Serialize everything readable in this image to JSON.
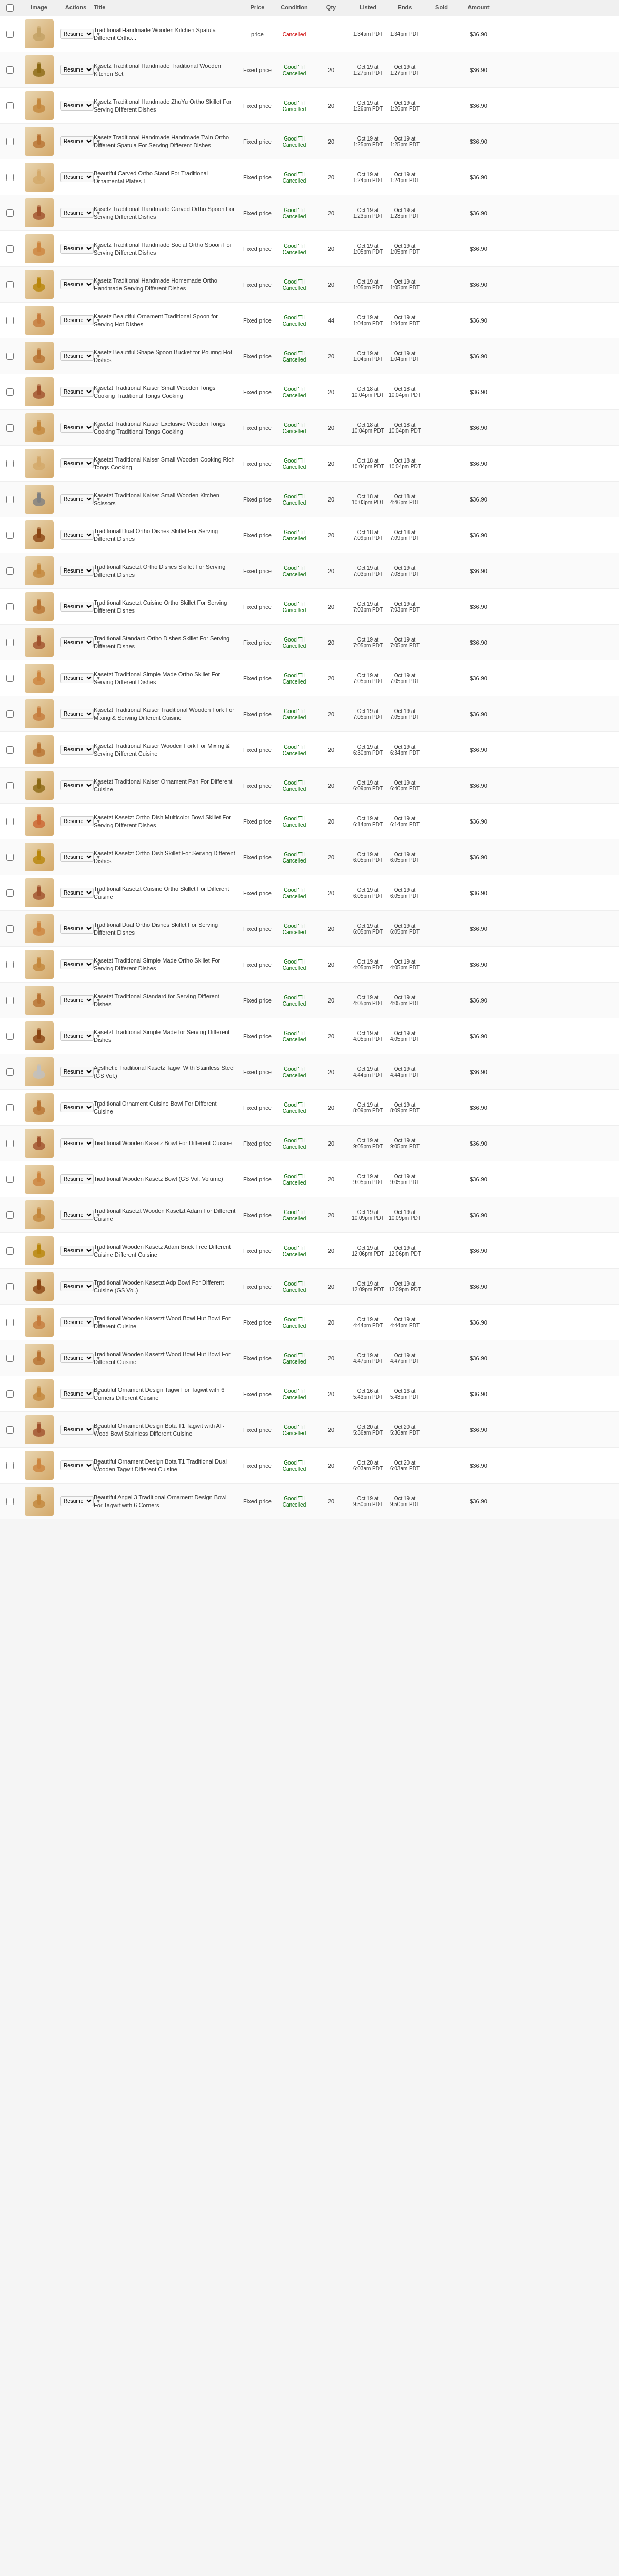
{
  "headers": {
    "check": "",
    "image": "Image",
    "actions": "Actions",
    "title": "Title",
    "price": "Price",
    "condition": "Condition",
    "qty": "Qty",
    "listed": "Listed",
    "ends": "Ends",
    "sold": "Sold",
    "amount": "Amount"
  },
  "rows": [
    {
      "id": 1,
      "title": "Traditional Handmade Wooden Kitchen Spatula Different Ortho...",
      "price": "price",
      "condition": "Cancelled",
      "qty": "",
      "listed": "1:34am PDT",
      "ends": "1:34pm PDT",
      "sold": "",
      "amount": "$36.90",
      "color": "#c4a265"
    },
    {
      "id": 2,
      "title": "Kasetz Traditional Handmade Traditional Wooden Kitchen Set",
      "price": "Fixed price",
      "condition": "Good 'Til Cancelled",
      "qty": "20",
      "listed": "Oct 19 at 1:27pm PDT",
      "ends": "Oct 19 at 1:27pm PDT",
      "sold": "",
      "amount": "$36.90",
      "color": "#8b6914"
    },
    {
      "id": 3,
      "title": "Kasetz Traditional Handmade ZhuYu Ortho Skillet For Serving Different Dishes",
      "price": "Fixed price",
      "condition": "Good 'Til Cancelled",
      "qty": "20",
      "listed": "Oct 19 at 1:26pm PDT",
      "ends": "Oct 19 at 1:26pm PDT",
      "sold": "",
      "amount": "$36.90",
      "color": "#c4873c"
    },
    {
      "id": 4,
      "title": "Kasetz Traditional Handmade Handmade Twin Ortho Different Spatula For Serving Different Dishes",
      "price": "Fixed price",
      "condition": "Good 'Til Cancelled",
      "qty": "20",
      "listed": "Oct 19 at 1:25pm PDT",
      "ends": "Oct 19 at 1:25pm PDT",
      "sold": "",
      "amount": "$36.90",
      "color": "#b87333"
    },
    {
      "id": 5,
      "title": "Beautiful Carved Ortho Stand For Traditional Ornamental Plates I",
      "price": "Fixed price",
      "condition": "Good 'Til Cancelled",
      "qty": "20",
      "listed": "Oct 19 at 1:24pm PDT",
      "ends": "Oct 19 at 1:24pm PDT",
      "sold": "",
      "amount": "$36.90",
      "color": "#d4a96a"
    },
    {
      "id": 6,
      "title": "Kasetz Traditional Handmade Carved Ortho Spoon For Serving Different Dishes",
      "price": "Fixed price",
      "condition": "Good 'Til Cancelled",
      "qty": "20",
      "listed": "Oct 19 at 1:23pm PDT",
      "ends": "Oct 19 at 1:23pm PDT",
      "sold": "",
      "amount": "$36.90",
      "color": "#a0522d"
    },
    {
      "id": 7,
      "title": "Kasetz Traditional Handmade Social Ortho Spoon For Serving Different Dishes",
      "price": "Fixed price",
      "condition": "Good 'Til Cancelled",
      "qty": "20",
      "listed": "Oct 19 at 1:05pm PDT",
      "ends": "Oct 19 at 1:05pm PDT",
      "sold": "",
      "amount": "$36.90",
      "color": "#cd853f"
    },
    {
      "id": 8,
      "title": "Kasetz Traditional Handmade Homemade Ortho Handmade Serving Different Dishes",
      "price": "Fixed price",
      "condition": "Good 'Til Cancelled",
      "qty": "20",
      "listed": "Oct 19 at 1:05pm PDT",
      "ends": "Oct 19 at 1:05pm PDT",
      "sold": "",
      "amount": "$36.90",
      "color": "#b8860b"
    },
    {
      "id": 9,
      "title": "Kasetz Beautiful Ornament Traditional Spoon for Serving Hot Dishes",
      "price": "Fixed price",
      "condition": "Good 'Til Cancelled",
      "qty": "44",
      "listed": "Oct 19 at 1:04pm PDT",
      "ends": "Oct 19 at 1:04pm PDT",
      "sold": "",
      "amount": "$36.90",
      "color": "#c67c3d"
    },
    {
      "id": 10,
      "title": "Kasetz Beautiful Shape Spoon Bucket for Pouring Hot Dishes",
      "price": "Fixed price",
      "condition": "Good 'Til Cancelled",
      "qty": "20",
      "listed": "Oct 19 at 1:04pm PDT",
      "ends": "Oct 19 at 1:04pm PDT",
      "sold": "",
      "amount": "$36.90",
      "color": "#b87333"
    },
    {
      "id": 11,
      "title": "Kasetzt Traditional Kaiser Small Wooden Tongs Cooking Traditional Tongs Cooking",
      "price": "Fixed price",
      "condition": "Good 'Til Cancelled",
      "qty": "20",
      "listed": "Oct 18 at 10:04pm PDT",
      "ends": "Oct 18 at 10:04pm PDT",
      "sold": "",
      "amount": "$36.90",
      "color": "#a0522d"
    },
    {
      "id": 12,
      "title": "Kasetzt Traditional Kaiser Exclusive Wooden Tongs Cooking Traditional Tongs Cooking",
      "price": "Fixed price",
      "condition": "Good 'Til Cancelled",
      "qty": "20",
      "listed": "Oct 18 at 10:04pm PDT",
      "ends": "Oct 18 at 10:04pm PDT",
      "sold": "",
      "amount": "$36.90",
      "color": "#c4873c"
    },
    {
      "id": 13,
      "title": "Kasetzt Traditional Kaiser Small Wooden Cooking Rich Tongs Cooking",
      "price": "Fixed price",
      "condition": "Good 'Til Cancelled",
      "qty": "20",
      "listed": "Oct 18 at 10:04pm PDT",
      "ends": "Oct 18 at 10:04pm PDT",
      "sold": "",
      "amount": "$36.90",
      "color": "#d4a96a"
    },
    {
      "id": 14,
      "title": "Kasetzt Traditional Kaiser Small Wooden Kitchen Scissors",
      "price": "Fixed price",
      "condition": "Good 'Til Cancelled",
      "qty": "20",
      "listed": "Oct 18 at 10:03pm PDT",
      "ends": "Oct 18 at 4:46pm PDT",
      "sold": "",
      "amount": "$36.90",
      "color": "#808080"
    },
    {
      "id": 15,
      "title": "Traditional Dual Ortho Dishes Skillet For Serving Different Dishes",
      "price": "Fixed price",
      "condition": "Good 'Til Cancelled",
      "qty": "20",
      "listed": "Oct 18 at 7:09pm PDT",
      "ends": "Oct 18 at 7:09pm PDT",
      "sold": "",
      "amount": "$36.90",
      "color": "#8b4513"
    },
    {
      "id": 16,
      "title": "Traditional Kasetzt Ortho Dishes Skillet For Serving Different Dishes",
      "price": "Fixed price",
      "condition": "Good 'Til Cancelled",
      "qty": "20",
      "listed": "Oct 19 at 7:03pm PDT",
      "ends": "Oct 19 at 7:03pm PDT",
      "sold": "",
      "amount": "$36.90",
      "color": "#c4873c"
    },
    {
      "id": 17,
      "title": "Traditional Kasetzt Cuisine Ortho Skillet For Serving Different Dishes",
      "price": "Fixed price",
      "condition": "Good 'Til Cancelled",
      "qty": "20",
      "listed": "Oct 19 at 7:03pm PDT",
      "ends": "Oct 19 at 7:03pm PDT",
      "sold": "",
      "amount": "$36.90",
      "color": "#b87333"
    },
    {
      "id": 18,
      "title": "Traditional Standard Ortho Dishes Skillet For Serving Different Dishes",
      "price": "Fixed price",
      "condition": "Good 'Til Cancelled",
      "qty": "20",
      "listed": "Oct 19 at 7:05pm PDT",
      "ends": "Oct 19 at 7:05pm PDT",
      "sold": "",
      "amount": "$36.90",
      "color": "#a0522d"
    },
    {
      "id": 19,
      "title": "Kasetzt Traditional Simple Made Ortho Skillet For Serving Different Dishes",
      "price": "Fixed price",
      "condition": "Good 'Til Cancelled",
      "qty": "20",
      "listed": "Oct 19 at 7:05pm PDT",
      "ends": "Oct 19 at 7:05pm PDT",
      "sold": "",
      "amount": "$36.90",
      "color": "#cd853f"
    },
    {
      "id": 20,
      "title": "Kasetzt Traditional Kaiser Traditional Wooden Fork For Mixing & Serving Different Cuisine",
      "price": "Fixed price",
      "condition": "Good 'Til Cancelled",
      "qty": "20",
      "listed": "Oct 19 at 7:05pm PDT",
      "ends": "Oct 19 at 7:05pm PDT",
      "sold": "",
      "amount": "$36.90",
      "color": "#c67c3d"
    },
    {
      "id": 21,
      "title": "Kasetzt Traditional Kaiser Wooden Fork For Mixing & Serving Different Cuisine",
      "price": "Fixed price",
      "condition": "Good 'Til Cancelled",
      "qty": "20",
      "listed": "Oct 19 at 6:30pm PDT",
      "ends": "Oct 19 at 6:34pm PDT",
      "sold": "",
      "amount": "$36.90",
      "color": "#b87333"
    },
    {
      "id": 22,
      "title": "Kasetzt Traditional Kaiser Ornament Pan For Different Cuisine",
      "price": "Fixed price",
      "condition": "Good 'Til Cancelled",
      "qty": "20",
      "listed": "Oct 19 at 6:09pm PDT",
      "ends": "Oct 19 at 6:40pm PDT",
      "sold": "",
      "amount": "$36.90",
      "color": "#8b6914"
    },
    {
      "id": 23,
      "title": "Kasetzt Kasetzt Ortho Dish Multicolor Bowl Skillet For Serving Different Dishes",
      "price": "Fixed price",
      "condition": "Good 'Til Cancelled",
      "qty": "20",
      "listed": "Oct 19 at 6:14pm PDT",
      "ends": "Oct 19 at 6:14pm PDT",
      "sold": "",
      "amount": "$36.90",
      "color": "#cc6633"
    },
    {
      "id": 24,
      "title": "Kasetzt Kasetzt Ortho Dish Skillet For Serving Different Dishes",
      "price": "Fixed price",
      "condition": "Good 'Til Cancelled",
      "qty": "20",
      "listed": "Oct 19 at 6:05pm PDT",
      "ends": "Oct 19 at 6:05pm PDT",
      "sold": "",
      "amount": "$36.90",
      "color": "#b8860b"
    },
    {
      "id": 25,
      "title": "Traditional Kasetzt Cuisine Ortho Skillet For Different Cuisine",
      "price": "Fixed price",
      "condition": "Good 'Til Cancelled",
      "qty": "20",
      "listed": "Oct 19 at 6:05pm PDT",
      "ends": "Oct 19 at 6:05pm PDT",
      "sold": "",
      "amount": "$36.90",
      "color": "#a0522d"
    },
    {
      "id": 26,
      "title": "Traditional Dual Ortho Dishes Skillet For Serving Different Dishes",
      "price": "Fixed price",
      "condition": "Good 'Til Cancelled",
      "qty": "20",
      "listed": "Oct 19 at 6:05pm PDT",
      "ends": "Oct 19 at 6:05pm PDT",
      "sold": "",
      "amount": "$36.90",
      "color": "#cd853f"
    },
    {
      "id": 27,
      "title": "Kasetzt Traditional Simple Made Ortho Skillet For Serving Different Dishes",
      "price": "Fixed price",
      "condition": "Good 'Til Cancelled",
      "qty": "20",
      "listed": "Oct 19 at 4:05pm PDT",
      "ends": "Oct 19 at 4:05pm PDT",
      "sold": "",
      "amount": "$36.90",
      "color": "#c4873c"
    },
    {
      "id": 28,
      "title": "Kasetzt Traditional Standard for Serving Different Dishes",
      "price": "Fixed price",
      "condition": "Good 'Til Cancelled",
      "qty": "20",
      "listed": "Oct 19 at 4:05pm PDT",
      "ends": "Oct 19 at 4:05pm PDT",
      "sold": "",
      "amount": "$36.90",
      "color": "#b87333"
    },
    {
      "id": 29,
      "title": "Kasetzt Traditional Simple Made for Serving Different Dishes",
      "price": "Fixed price",
      "condition": "Good 'Til Cancelled",
      "qty": "20",
      "listed": "Oct 19 at 4:05pm PDT",
      "ends": "Oct 19 at 4:05pm PDT",
      "sold": "",
      "amount": "$36.90",
      "color": "#8b4513"
    },
    {
      "id": 30,
      "title": "Aesthetic Traditional Kasetz Tagwi With Stainless Steel (GS Vol.)",
      "price": "Fixed price",
      "condition": "Good 'Til Cancelled",
      "qty": "20",
      "listed": "Oct 19 at 4:44pm PDT",
      "ends": "Oct 19 at 4:44pm PDT",
      "sold": "",
      "amount": "$36.90",
      "color": "#c0c0c0"
    },
    {
      "id": 31,
      "title": "Traditional Ornament Cuisine Bowl For Different Cuisine",
      "price": "Fixed price",
      "condition": "Good 'Til Cancelled",
      "qty": "20",
      "listed": "Oct 19 at 8:09pm PDT",
      "ends": "Oct 19 at 8:09pm PDT",
      "sold": "",
      "amount": "$36.90",
      "color": "#b87333"
    },
    {
      "id": 32,
      "title": "Traditional Wooden Kasetz Bowl For Different Cuisine",
      "price": "Fixed price",
      "condition": "Good 'Til Cancelled",
      "qty": "20",
      "listed": "Oct 19 at 9:05pm PDT",
      "ends": "Oct 19 at 9:05pm PDT",
      "sold": "",
      "amount": "$36.90",
      "color": "#a0522d"
    },
    {
      "id": 33,
      "title": "Traditional Wooden Kasetz Bowl (GS Vol. Volume)",
      "price": "Fixed price",
      "condition": "Good 'Til Cancelled",
      "qty": "20",
      "listed": "Oct 19 at 9:05pm PDT",
      "ends": "Oct 19 at 9:05pm PDT",
      "sold": "",
      "amount": "$36.90",
      "color": "#cd853f"
    },
    {
      "id": 34,
      "title": "Traditional Kasetzt Wooden Kasetzt Adam For Different Cuisine",
      "price": "Fixed price",
      "condition": "Good 'Til Cancelled",
      "qty": "20",
      "listed": "Oct 19 at 10:09pm PDT",
      "ends": "Oct 19 at 10:09pm PDT",
      "sold": "",
      "amount": "$36.90",
      "color": "#c4873c"
    },
    {
      "id": 35,
      "title": "Traditional Wooden Kasetz Adam Brick Free Different Cuisine Different Cuisine",
      "price": "Fixed price",
      "condition": "Good 'Til Cancelled",
      "qty": "20",
      "listed": "Oct 19 at 12:06pm PDT",
      "ends": "Oct 19 at 12:06pm PDT",
      "sold": "",
      "amount": "$36.90",
      "color": "#b8860b"
    },
    {
      "id": 36,
      "title": "Traditional Wooden Kasetzt Adp Bowl For Different Cuisine (GS Vol.)",
      "price": "Fixed price",
      "condition": "Good 'Til Cancelled",
      "qty": "20",
      "listed": "Oct 19 at 12:09pm PDT",
      "ends": "Oct 19 at 12:09pm PDT",
      "sold": "",
      "amount": "$36.90",
      "color": "#8b4513"
    },
    {
      "id": 37,
      "title": "Traditional Wooden Kasetzt Wood Bowl Hut Bowl For Different Cuisine",
      "price": "Fixed price",
      "condition": "Good 'Til Cancelled",
      "qty": "20",
      "listed": "Oct 19 at 4:44pm PDT",
      "ends": "Oct 19 at 4:44pm PDT",
      "sold": "",
      "amount": "$36.90",
      "color": "#c67c3d"
    },
    {
      "id": 38,
      "title": "Traditional Wooden Kasetzt Wood Bowl Hut Bowl For Different Cuisine",
      "price": "Fixed price",
      "condition": "Good 'Til Cancelled",
      "qty": "20",
      "listed": "Oct 19 at 4:47pm PDT",
      "ends": "Oct 19 at 4:47pm PDT",
      "sold": "",
      "amount": "$36.90",
      "color": "#b87333"
    },
    {
      "id": 39,
      "title": "Beautiful Ornament Design Tagwi For Tagwit with 6 Corners Different Cuisine",
      "price": "Fixed price",
      "condition": "Good 'Til Cancelled",
      "qty": "20",
      "listed": "Oct 16 at 5:43pm PDT",
      "ends": "Oct 16 at 5:43pm PDT",
      "sold": "",
      "amount": "$36.90",
      "color": "#c4873c"
    },
    {
      "id": 40,
      "title": "Beautiful Ornament Design Bota T1 Tagwit with All-Wood Bowl Stainless Different Cuisine",
      "price": "Fixed price",
      "condition": "Good 'Til Cancelled",
      "qty": "20",
      "listed": "Oct 20 at 5:36am PDT",
      "ends": "Oct 20 at 5:36am PDT",
      "sold": "",
      "amount": "$36.90",
      "color": "#a0522d"
    },
    {
      "id": 41,
      "title": "Beautiful Ornament Design Bota T1 Traditional Dual Wooden Tagwit Different Cuisine",
      "price": "Fixed price",
      "condition": "Good 'Til Cancelled",
      "qty": "20",
      "listed": "Oct 20 at 6:03am PDT",
      "ends": "Oct 20 at 6:03am PDT",
      "sold": "",
      "amount": "$36.90",
      "color": "#cd853f"
    },
    {
      "id": 42,
      "title": "Beautiful Angel 3 Traditional Ornament Design Bowl For Tagwit with 6 Corners",
      "price": "Fixed price",
      "condition": "Good 'Til Cancelled",
      "qty": "20",
      "listed": "Oct 19 at 9:50pm PDT",
      "ends": "Oct 19 at 9:50pm PDT",
      "sold": "",
      "amount": "$36.90",
      "color": "#c4873c"
    }
  ]
}
